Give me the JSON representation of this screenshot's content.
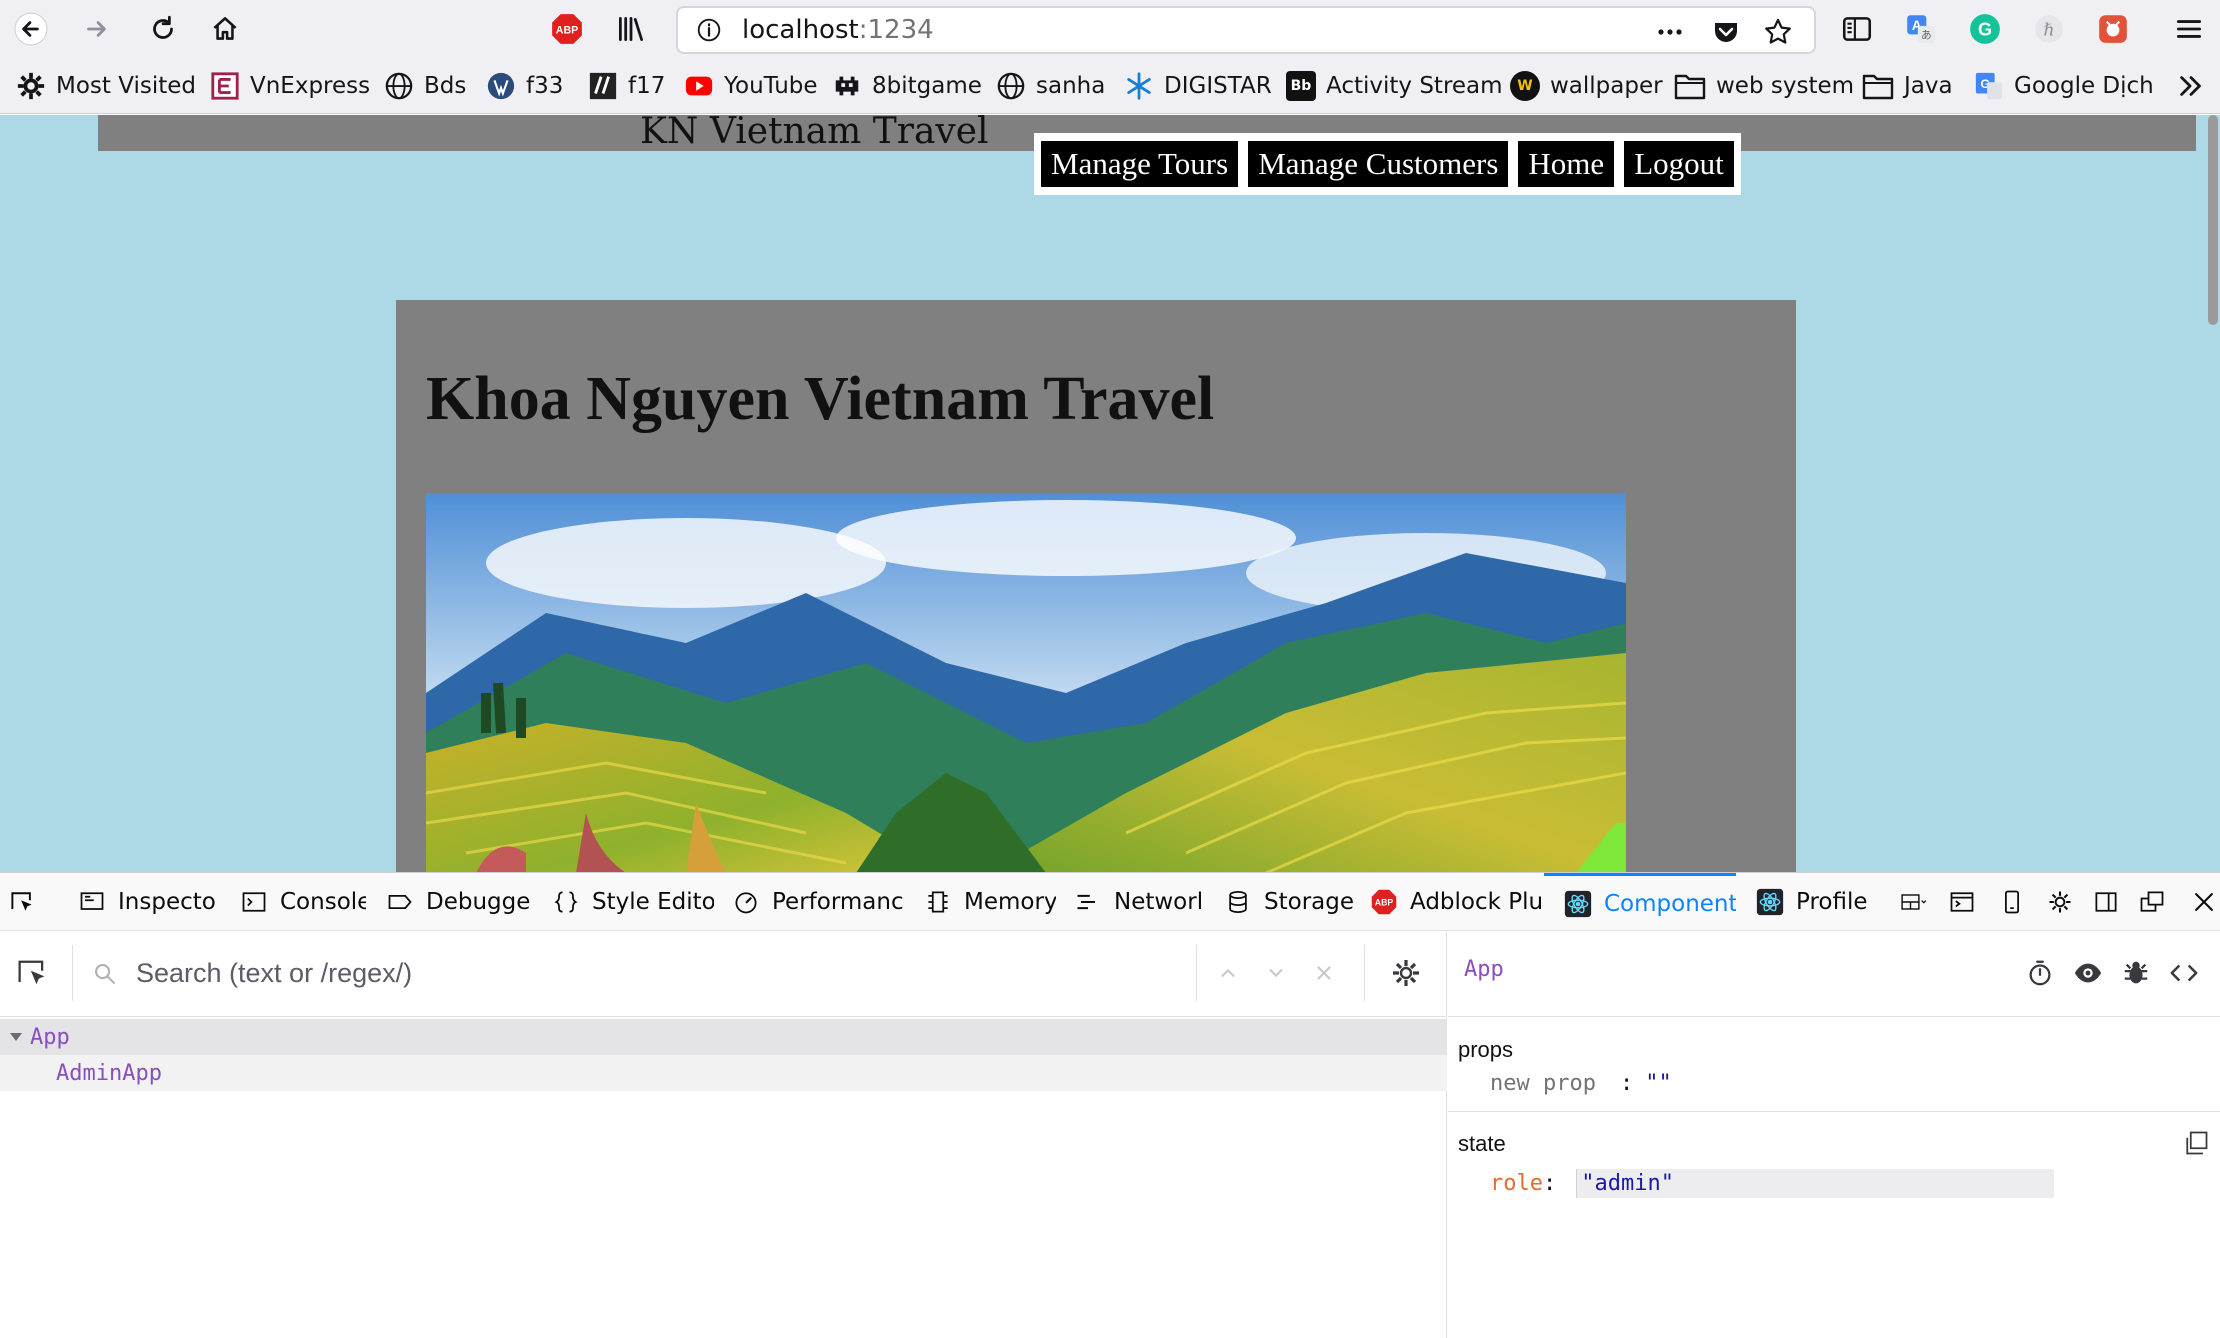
{
  "browser": {
    "url_host": "localhost",
    "url_port": ":1234"
  },
  "bookmarks": [
    {
      "label": "Most Visited",
      "icon": "gear-icon"
    },
    {
      "label": "VnExpress",
      "icon": "vnexpress-icon"
    },
    {
      "label": "Bds",
      "icon": "globe-icon"
    },
    {
      "label": "f33",
      "icon": "wordpress-icon"
    },
    {
      "label": "f17",
      "icon": "f17-icon"
    },
    {
      "label": "YouTube",
      "icon": "youtube-icon"
    },
    {
      "label": "8bitgame",
      "icon": "space-invader-icon"
    },
    {
      "label": "sanha",
      "icon": "globe-icon"
    },
    {
      "label": "DIGISTAR",
      "icon": "digistar-icon"
    },
    {
      "label": "Activity Stream",
      "icon": "blackboard-icon",
      "icon_text": "Bb"
    },
    {
      "label": "wallpaper",
      "icon": "wallpaper-icon",
      "icon_text": "W"
    },
    {
      "label": "web system",
      "icon": "folder-icon"
    },
    {
      "label": "Java",
      "icon": "folder-icon"
    },
    {
      "label": "Google Dịch",
      "icon": "google-translate-icon"
    }
  ],
  "extensions": {
    "abp": "ABP"
  },
  "page": {
    "site_title": "KN Vietnam Travel",
    "nav": [
      "Manage Tours",
      "Manage Customers",
      "Home",
      "Logout"
    ],
    "heading": "Khoa Nguyen Vietnam Travel"
  },
  "devtools": {
    "tabs": [
      "Inspecto",
      "Console",
      "Debugge",
      "Style Edito",
      "Performanc",
      "Memory",
      "Networl",
      "Storage",
      "Adblock Plu",
      "Component",
      "Profile"
    ],
    "active_tab": "Component",
    "search_placeholder": "Search (text or /regex/)",
    "tree": [
      "App",
      "AdminApp"
    ],
    "selected_component": "App",
    "props_label": "props",
    "new_prop_key": "new prop",
    "new_prop_sep": ":",
    "new_prop_value": "\"\"",
    "state_label": "state",
    "state_key": "role",
    "state_sep": ":",
    "state_value": "\"admin\""
  },
  "colors": {
    "page_bg": "#add8e6",
    "nav_strip": "#808080",
    "content_box": "#808080",
    "active_tab": "#0a84ff",
    "component_purple": "#8a4ebf",
    "state_key": "#e26d2d",
    "state_value": "#1a1aa6"
  }
}
